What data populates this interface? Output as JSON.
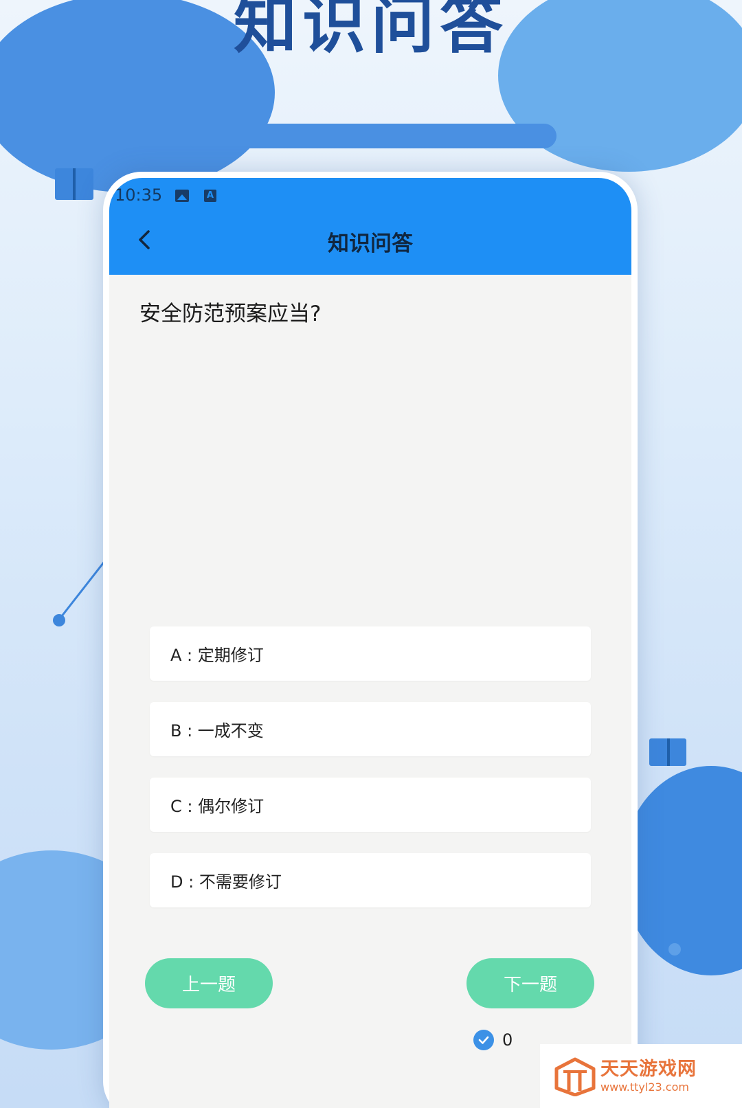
{
  "hero": {
    "title": "知识问答"
  },
  "status_bar": {
    "time": "10:35",
    "icons": [
      "image-icon",
      "a-icon"
    ]
  },
  "header": {
    "title": "知识问答",
    "back_icon": "chevron-left-icon"
  },
  "quiz": {
    "question": "安全防范预案应当?",
    "options": [
      {
        "label": "A : 定期修订"
      },
      {
        "label": "B : 一成不变"
      },
      {
        "label": "C : 偶尔修订"
      },
      {
        "label": "D : 不需要修订"
      }
    ],
    "prev_label": "上一题",
    "next_label": "下一题",
    "score": "0"
  },
  "watermark": {
    "name": "天天游戏网",
    "url": "www.ttyl23.com"
  },
  "colors": {
    "header": "#1e8ff5",
    "nav_button": "#64d9ac",
    "check": "#3c91e6",
    "watermark": "#e8743b"
  }
}
